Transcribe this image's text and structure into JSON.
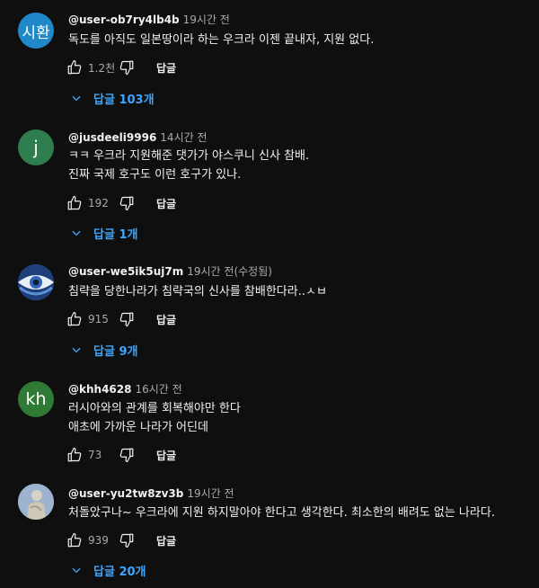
{
  "labels": {
    "reply": "답글"
  },
  "comments": [
    {
      "avatar_text": "시환",
      "avatar_color": "#1e88c8",
      "author": "@user-ob7ry4lb4b",
      "time": "19시간 전",
      "lines": [
        "독도를 아직도 일본땅이라 하는 우크라 이젠 끝내자, 지원 없다."
      ],
      "likes": "1.2천",
      "replies": "답글 103개"
    },
    {
      "avatar_text": "j",
      "avatar_color": "#2e7d4f",
      "author": "@jusdeeli9996",
      "time": "14시간 전",
      "lines": [
        "ㅋㅋ 우크라 지원해준 댓가가 야스쿠니 신사 참배.",
        "진짜 국제 호구도 이런 호구가 있나."
      ],
      "likes": "192",
      "replies": "답글 1개"
    },
    {
      "avatar_text": "",
      "avatar_icon": "eye-avatar",
      "avatar_color": "#3a6fb0",
      "author": "@user-we5ik5uj7m",
      "time": "19시간 전(수정됨)",
      "lines": [
        "침략을 당한나라가 침략국의 신사를 참배한다라..ㅅㅂ"
      ],
      "likes": "915",
      "replies": "답글 9개"
    },
    {
      "avatar_text": "kh",
      "avatar_color": "#2f7a34",
      "author": "@khh4628",
      "time": "16시간 전",
      "lines": [
        "러시아와의 관계를 회복해야만 한다",
        "애초에 가까운 나라가 어딘데"
      ],
      "likes": "73",
      "replies": ""
    },
    {
      "avatar_text": "",
      "avatar_icon": "statue-avatar",
      "avatar_color": "#8fa6c4",
      "author": "@user-yu2tw8zv3b",
      "time": "19시간 전",
      "lines": [
        "처돌았구나~ 우크라에 지원 하지말아야 한다고 생각한다. 최소한의 배려도 없는 나라다."
      ],
      "likes": "939",
      "replies": "답글 20개"
    }
  ]
}
